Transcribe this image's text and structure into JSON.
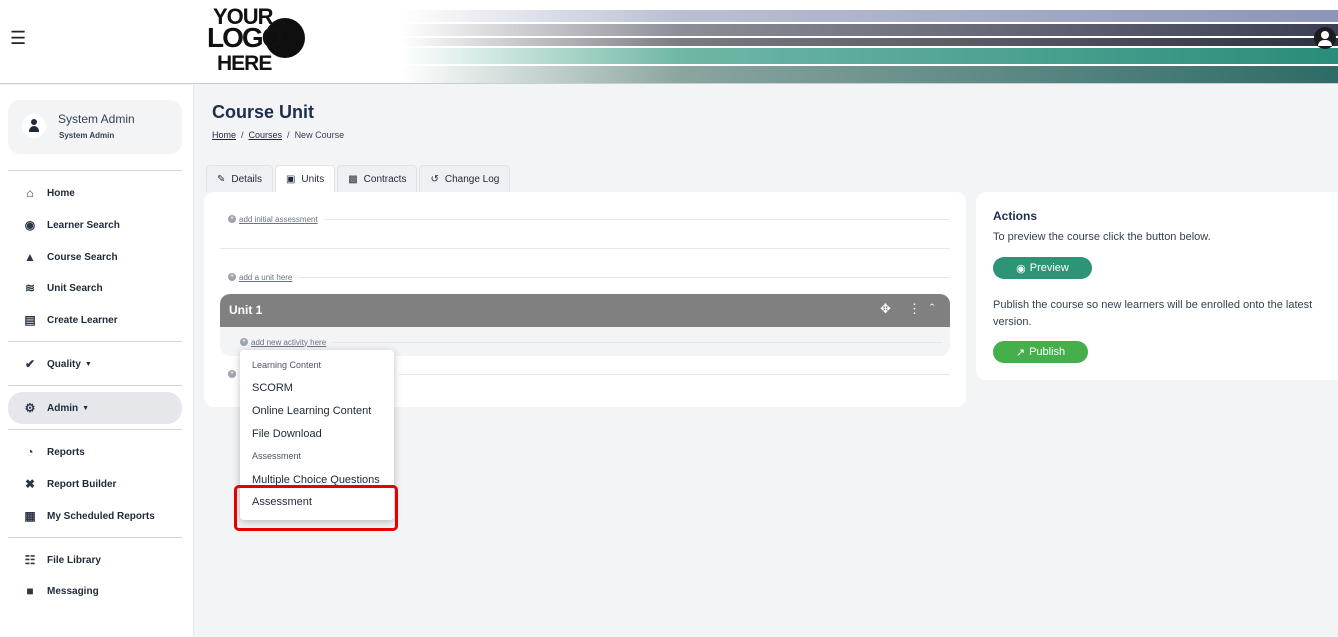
{
  "header": {
    "menu_icon": "hamburger-icon",
    "logo": {
      "line1": "YOUR",
      "line2": "LOGO",
      "line3": "HERE"
    },
    "user_icon": "user-circle-icon"
  },
  "sidebar": {
    "profile": {
      "name": "System Admin",
      "role": "System Admin"
    },
    "items": [
      {
        "label": "Home",
        "icon": "home-icon"
      },
      {
        "label": "Learner Search",
        "icon": "user-circle-icon"
      },
      {
        "label": "Course Search",
        "icon": "graduate-icon"
      },
      {
        "label": "Unit Search",
        "icon": "skiing-icon"
      },
      {
        "label": "Create Learner",
        "icon": "clipboard-icon"
      },
      {
        "label": "Quality",
        "icon": "check-circle-icon"
      },
      {
        "label": "Admin",
        "icon": "gears-icon"
      },
      {
        "label": "Reports",
        "icon": "pie-chart-icon"
      },
      {
        "label": "Report Builder",
        "icon": "tools-icon"
      },
      {
        "label": "My Scheduled Reports",
        "icon": "calendar-icon"
      },
      {
        "label": "File Library",
        "icon": "library-icon"
      },
      {
        "label": "Messaging",
        "icon": "message-icon"
      }
    ]
  },
  "page": {
    "title": "Course Unit",
    "breadcrumb": {
      "home": "Home",
      "sep1": "/",
      "courses": "Courses",
      "sep2": "/",
      "current": "New Course"
    }
  },
  "tabs": [
    {
      "label": "Details",
      "icon": "pencil-icon"
    },
    {
      "label": "Units",
      "icon": "cube-icon"
    },
    {
      "label": "Contracts",
      "icon": "document-icon"
    },
    {
      "label": "Change Log",
      "icon": "history-icon"
    }
  ],
  "units": {
    "add_initial_assessment": "add initial assessment",
    "add_unit_here": "add a unit here",
    "unit_title": "Unit 1",
    "add_activity": "add new activity here"
  },
  "dropdown": {
    "heading_learning": "Learning Content",
    "scorm": "SCORM",
    "online_learning": "Online Learning Content",
    "file_download": "File Download",
    "heading_assessment": "Assessment",
    "mcq": "Multiple Choice Questions",
    "assessment": "Assessment"
  },
  "actions": {
    "title": "Actions",
    "preview_text": "To preview the course click the button below.",
    "preview_label": "Preview",
    "publish_text": "Publish the course so new learners will be enrolled onto the latest version.",
    "publish_label": "Publish"
  }
}
